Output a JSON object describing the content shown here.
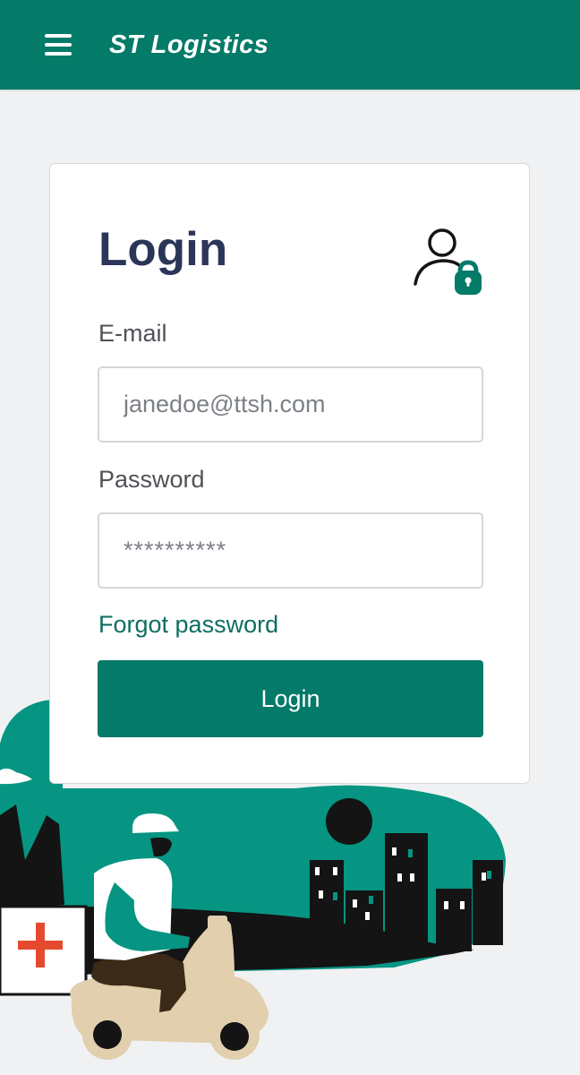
{
  "header": {
    "logo_text": "ST Logistics",
    "menu_icon": "hamburger-menu-icon",
    "background_color": "#047a68"
  },
  "login_card": {
    "title": "Login",
    "title_icon": "user-lock-icon",
    "email": {
      "label": "E-mail",
      "placeholder": "janedoe@ttsh.com"
    },
    "password": {
      "label": "Password",
      "placeholder": "**********"
    },
    "forgot_password_link": "Forgot password",
    "submit_label": "Login"
  },
  "illustration": {
    "description_icon": "delivery-scooter-illustration",
    "accent_color": "#069582"
  },
  "colors": {
    "primary": "#047a68",
    "title_text": "#2b3558",
    "link": "#0d6e61",
    "page_background": "#f0f1f3"
  }
}
